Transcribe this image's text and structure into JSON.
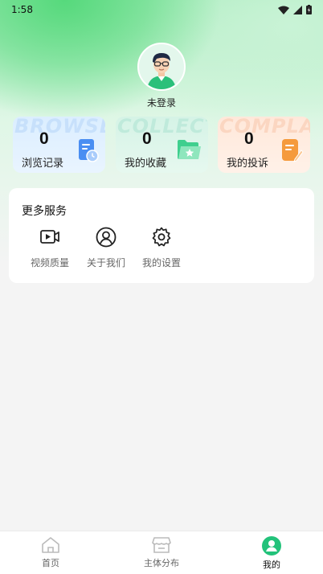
{
  "status_bar": {
    "time": "1:58"
  },
  "profile": {
    "login_text": "未登录"
  },
  "stats": [
    {
      "bg_word": "BROWSE",
      "count": "0",
      "label": "浏览记录",
      "icon": "history-doc-icon",
      "color": "#4a8ef2"
    },
    {
      "bg_word": "COLLECT",
      "count": "0",
      "label": "我的收藏",
      "icon": "star-folder-icon",
      "color": "#3fcf8e"
    },
    {
      "bg_word": "COMPLAIN",
      "count": "0",
      "label": "我的投诉",
      "icon": "edit-doc-icon",
      "color": "#f59a3c"
    }
  ],
  "services": {
    "title": "更多服务",
    "items": [
      {
        "label": "视频质量",
        "icon": "video-icon"
      },
      {
        "label": "关于我们",
        "icon": "user-circle-icon"
      },
      {
        "label": "我的设置",
        "icon": "gear-icon"
      }
    ]
  },
  "tabbar": {
    "items": [
      {
        "label": "首页",
        "icon": "home-icon",
        "active": false
      },
      {
        "label": "主体分布",
        "icon": "store-icon",
        "active": false
      },
      {
        "label": "我的",
        "icon": "profile-icon",
        "active": true
      }
    ]
  },
  "colors": {
    "accent": "#22c27a"
  }
}
